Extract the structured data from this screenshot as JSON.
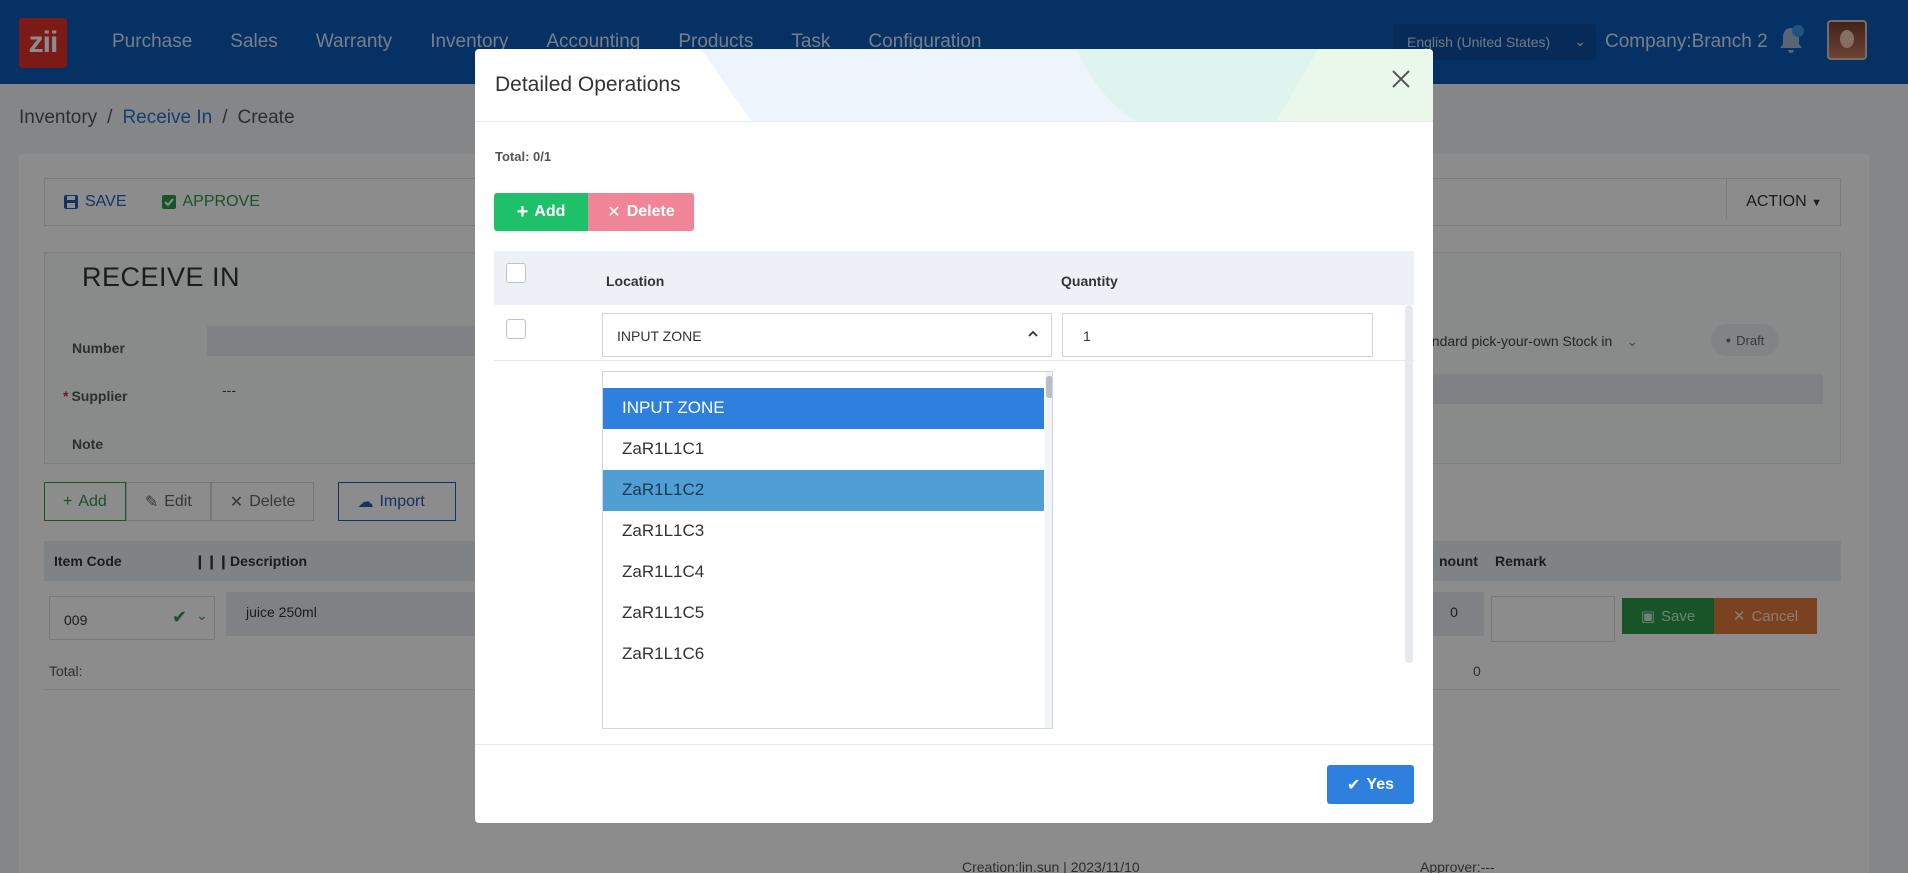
{
  "topbar": {
    "logo": "zii",
    "nav": [
      "Purchase",
      "Sales",
      "Warranty",
      "Inventory",
      "Accounting",
      "Products",
      "Task",
      "Configuration"
    ],
    "language": "English (United States)",
    "company": "Company:Branch 2"
  },
  "breadcrumb": {
    "root": "Inventory",
    "sep1": "/",
    "link": "Receive In",
    "sep2": "/",
    "current": "Create"
  },
  "toolbar": {
    "save": "SAVE",
    "approve": "APPROVE",
    "action": "ACTION"
  },
  "form": {
    "title": "RECEIVE IN",
    "number_label": "Number",
    "supplier_label": "Supplier",
    "supplier_value": "---",
    "note_label": "Note",
    "type_value": "andard pick-your-own Stock in",
    "status": "Draft"
  },
  "actions": {
    "add": "Add",
    "edit": "Edit",
    "delete": "Delete",
    "import": "Import"
  },
  "grid": {
    "col_item_code": "Item Code",
    "col_description": "Description",
    "col_amount": "nount",
    "col_remark": "Remark",
    "row": {
      "item_code": "009",
      "description": "juice 250ml",
      "amount": "0"
    },
    "save": "Save",
    "cancel": "Cancel",
    "total_label": "Total:",
    "total_value": "0"
  },
  "footer": {
    "creation": "Creation:lin.sun | 2023/11/10",
    "approver": "Approver:---"
  },
  "modal": {
    "title": "Detailed Operations",
    "total": "Total: 0/1",
    "add": "Add",
    "delete": "Delete",
    "col_location": "Location",
    "col_quantity": "Quantity",
    "row": {
      "location": "INPUT ZONE",
      "quantity": "1"
    },
    "dropdown": [
      "INPUT ZONE",
      "ZaR1L1C1",
      "ZaR1L1C2",
      "ZaR1L1C3",
      "ZaR1L1C4",
      "ZaR1L1C5",
      "ZaR1L1C6"
    ],
    "yes": "Yes"
  },
  "colors": {
    "topbar": "#0b59b8",
    "add_green": "#1fc06a",
    "delete_pink": "#f08597",
    "selected_blue": "#2f7fdf",
    "hover_blue": "#4f9fd4",
    "save_green": "#2a9a48",
    "cancel_orange": "#e0783a"
  }
}
